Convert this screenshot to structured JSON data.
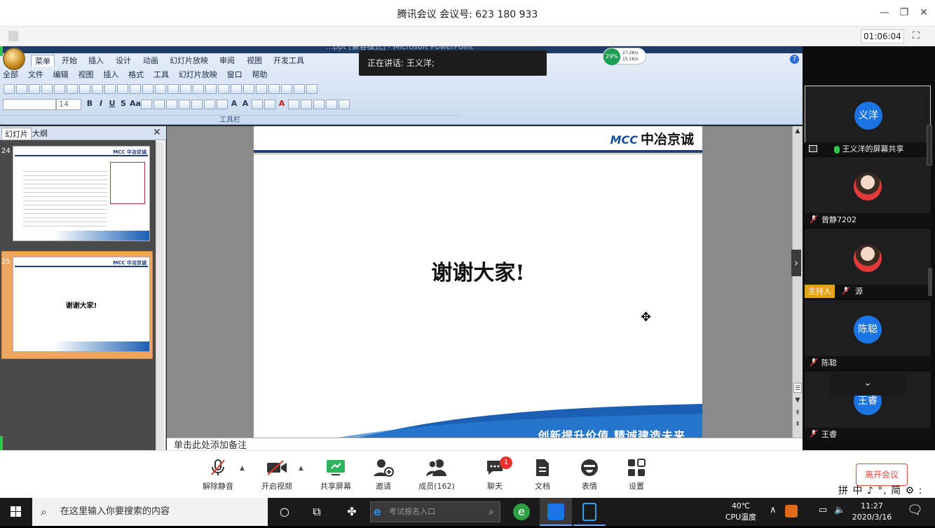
{
  "window": {
    "title": "腾讯会议 会议号: 623 180 933",
    "minimize": "—",
    "restore": "❐",
    "close": "✕"
  },
  "timer": "01:06:04",
  "speaker_tip": "正在讲话: 王义洋;",
  "ppt": {
    "window_caption": "...ppt [兼容模式] - Microsoft PowerPoint",
    "tabs": [
      "菜单",
      "开始",
      "插入",
      "设计",
      "动画",
      "幻灯片放映",
      "审阅",
      "视图",
      "开发工具"
    ],
    "menu": [
      "全部",
      "文件",
      "编辑",
      "视图",
      "插入",
      "格式",
      "工具",
      "幻灯片放映",
      "窗口",
      "帮助"
    ],
    "font_size": "14",
    "toolbar_label": "工具栏",
    "panel_tabs": [
      "幻灯片",
      "大纲"
    ],
    "thumb_numbers": [
      "24",
      "25"
    ],
    "thumb_thanks": "谢谢大家!",
    "thumb_logo": "MCC 中冶京诚",
    "slide": {
      "logo_mcc": "MCC",
      "logo_text": "中冶京诚",
      "thanks": "谢谢大家!",
      "slogan": "创新提升价值    精诚建造未来"
    },
    "notes": "单击此处添加备注"
  },
  "cpu_widget": {
    "percent": "29%",
    "up": "27.2K/s",
    "down": "15.1K/s"
  },
  "participants": [
    {
      "avatar": "义洋",
      "name": "王义洋的屏幕共享",
      "type": "share"
    },
    {
      "avatar": "",
      "name": "曾静7202",
      "type": "photo"
    },
    {
      "avatar": "",
      "name": "源",
      "type": "host",
      "badge": "主持人"
    },
    {
      "avatar": "陈聪",
      "name": "陈聪",
      "type": "normal"
    },
    {
      "avatar": "王睿",
      "name": "王睿",
      "type": "normal"
    }
  ],
  "controls": [
    "解除静音",
    "开启视频",
    "共享屏幕",
    "邀请",
    "成员(162)",
    "聊天",
    "文档",
    "表情",
    "设置"
  ],
  "chat_badge": "1",
  "leave": "离开会议",
  "ime": "拼 中 ♪ °, 简 ⚙ :",
  "taskbar": {
    "search_placeholder": "在这里输入你要搜索的内容",
    "ie_search": "考试报名入口",
    "cpu_temp": "40℃",
    "cpu_label": "CPU温度",
    "time": "11:27",
    "date": "2020/3/16"
  }
}
